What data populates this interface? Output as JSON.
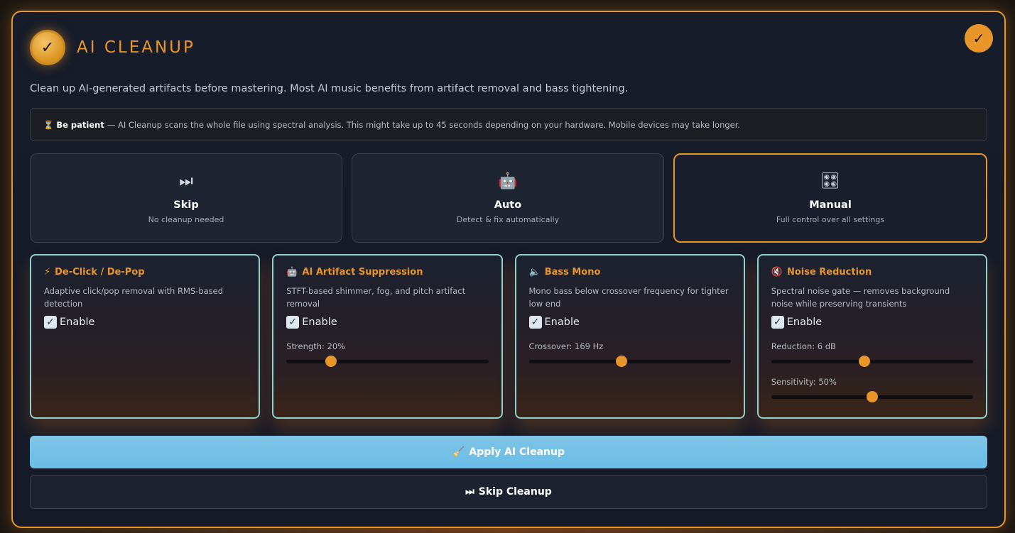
{
  "header": {
    "title": "AI CLEANUP",
    "logo_icon": "check-icon",
    "logo_glyph": "✓",
    "corner_glyph": "✓"
  },
  "description": "Clean up AI-generated artifacts before mastering. Most AI music benefits from artifact removal and bass tightening.",
  "notice": {
    "icon": "⏳",
    "bold": "Be patient",
    "text": "— AI Cleanup scans the whole file using spectral analysis. This might take up to 45 seconds depending on your hardware. Mobile devices may take longer."
  },
  "modes": [
    {
      "icon": "⏭",
      "label": "Skip",
      "sub": "No cleanup needed",
      "active": false
    },
    {
      "icon": "🤖",
      "label": "Auto",
      "sub": "Detect & fix automatically",
      "active": false
    },
    {
      "icon": "🎛",
      "label": "Manual",
      "sub": "Full control over all settings",
      "active": true
    }
  ],
  "cards": [
    {
      "icon": "⚡",
      "title": "De-Click / De-Pop",
      "desc": "Adaptive click/pop removal with RMS-based detection",
      "enable_label": "Enable",
      "enabled": true,
      "sliders": []
    },
    {
      "icon": "🤖",
      "title": "AI Artifact Suppression",
      "desc": "STFT-based shimmer, fog, and pitch artifact removal",
      "enable_label": "Enable",
      "enabled": true,
      "sliders": [
        {
          "label": "Strength: 20%",
          "value": 0.22
        }
      ]
    },
    {
      "icon": "🔈",
      "title": "Bass Mono",
      "desc": "Mono bass below crossover frequency for tighter low end",
      "enable_label": "Enable",
      "enabled": true,
      "sliders": [
        {
          "label": "Crossover: 169 Hz",
          "value": 0.46
        }
      ]
    },
    {
      "icon": "🔇",
      "title": "Noise Reduction",
      "desc": "Spectral noise gate — removes background noise while preserving transients",
      "enable_label": "Enable",
      "enabled": true,
      "sliders": [
        {
          "label": "Reduction: 6 dB",
          "value": 0.46
        },
        {
          "label": "Sensitivity: 50%",
          "value": 0.5
        }
      ]
    }
  ],
  "actions": {
    "apply_icon": "🧹",
    "apply_label": "Apply AI Cleanup",
    "skip_icon": "⏭",
    "skip_label": "Skip Cleanup"
  },
  "colors": {
    "accent": "#e8962a",
    "card_border": "#8fd0d0",
    "apply_button": "#6fc0e8"
  }
}
